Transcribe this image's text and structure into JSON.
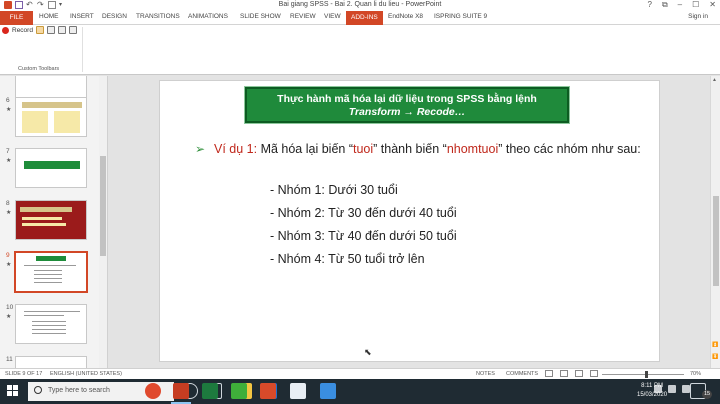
{
  "window": {
    "title": "Bai giang SPSS - Bai 2. Quan li du lieu - PowerPoint",
    "controls": [
      "?",
      "⧉",
      "–",
      "☐",
      "✕"
    ]
  },
  "ribbon_tabs": {
    "file": "FILE",
    "items": [
      "HOME",
      "INSERT",
      "DESIGN",
      "TRANSITIONS",
      "ANIMATIONS",
      "SLIDE SHOW",
      "REVIEW",
      "VIEW",
      "ADD-INS",
      "EndNote X8",
      "ISPRING SUITE 9"
    ],
    "active": "ADD-INS",
    "sign_in": "Sign in"
  },
  "ribbon": {
    "record_label": "Record",
    "group_label": "Custom Toolbars"
  },
  "thumbnails": [
    {
      "number": "6",
      "star": "★"
    },
    {
      "number": "7",
      "star": "★"
    },
    {
      "number": "8",
      "star": "★"
    },
    {
      "number": "9",
      "star": "★"
    },
    {
      "number": "10",
      "star": "★"
    },
    {
      "number": "11",
      "star": ""
    }
  ],
  "slide": {
    "title_line1": "Thực hành mã hóa lại dữ liệu trong SPSS bằng lệnh",
    "title_line2": "Transform → Recode…",
    "bullet_prefix": "Ví dụ 1:",
    "bullet_text_a": " Mã hóa lại biến “",
    "bullet_var1": "tuoi",
    "bullet_text_b": "” thành biến “",
    "bullet_var2": "nhomtuoi",
    "bullet_text_c": "” theo các nhóm như sau:",
    "sub_items": [
      "- Nhóm 1: Dưới 30 tuổi",
      "- Nhóm 2: Từ 30 đến dưới 40 tuổi",
      "- Nhóm 3: Từ 40 đến dưới 50 tuổi",
      "- Nhóm 4: Từ 50 tuổi trở lên"
    ]
  },
  "status_bar": {
    "slide_info": "SLIDE 9 OF 17",
    "language": "ENGLISH (UNITED STATES)",
    "notes": "NOTES",
    "comments": "COMMENTS",
    "zoom": "70%"
  },
  "taskbar": {
    "search_placeholder": "Type here to search",
    "time": "8:11 PM",
    "date": "15/03/2020",
    "notification_count": "15"
  },
  "colors": {
    "powerpoint_accent": "#d24726",
    "title_box": "#1f8a3b",
    "red_text": "#c0281c",
    "taskbar": "#1f2b33"
  }
}
